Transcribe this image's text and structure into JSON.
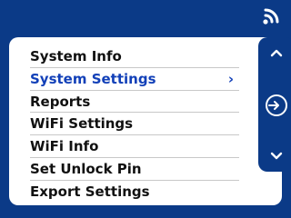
{
  "status_bar": {
    "signal_icon": "wifi-icon"
  },
  "menu": {
    "items": [
      {
        "label": "System Info"
      },
      {
        "label": "System Settings",
        "selected": true,
        "chevron": "›"
      },
      {
        "label": "Reports"
      },
      {
        "label": "WiFi Settings"
      },
      {
        "label": "WiFi Info"
      },
      {
        "label": "Set Unlock Pin"
      },
      {
        "label": "Export Settings"
      }
    ]
  },
  "side_controls": {
    "up_icon": "chevron-up-icon",
    "enter_icon": "enter-icon",
    "down_icon": "chevron-down-icon"
  },
  "colors": {
    "background": "#0b3a87",
    "panel": "#ffffff",
    "selected_text": "#1240b8",
    "text": "#111111"
  }
}
